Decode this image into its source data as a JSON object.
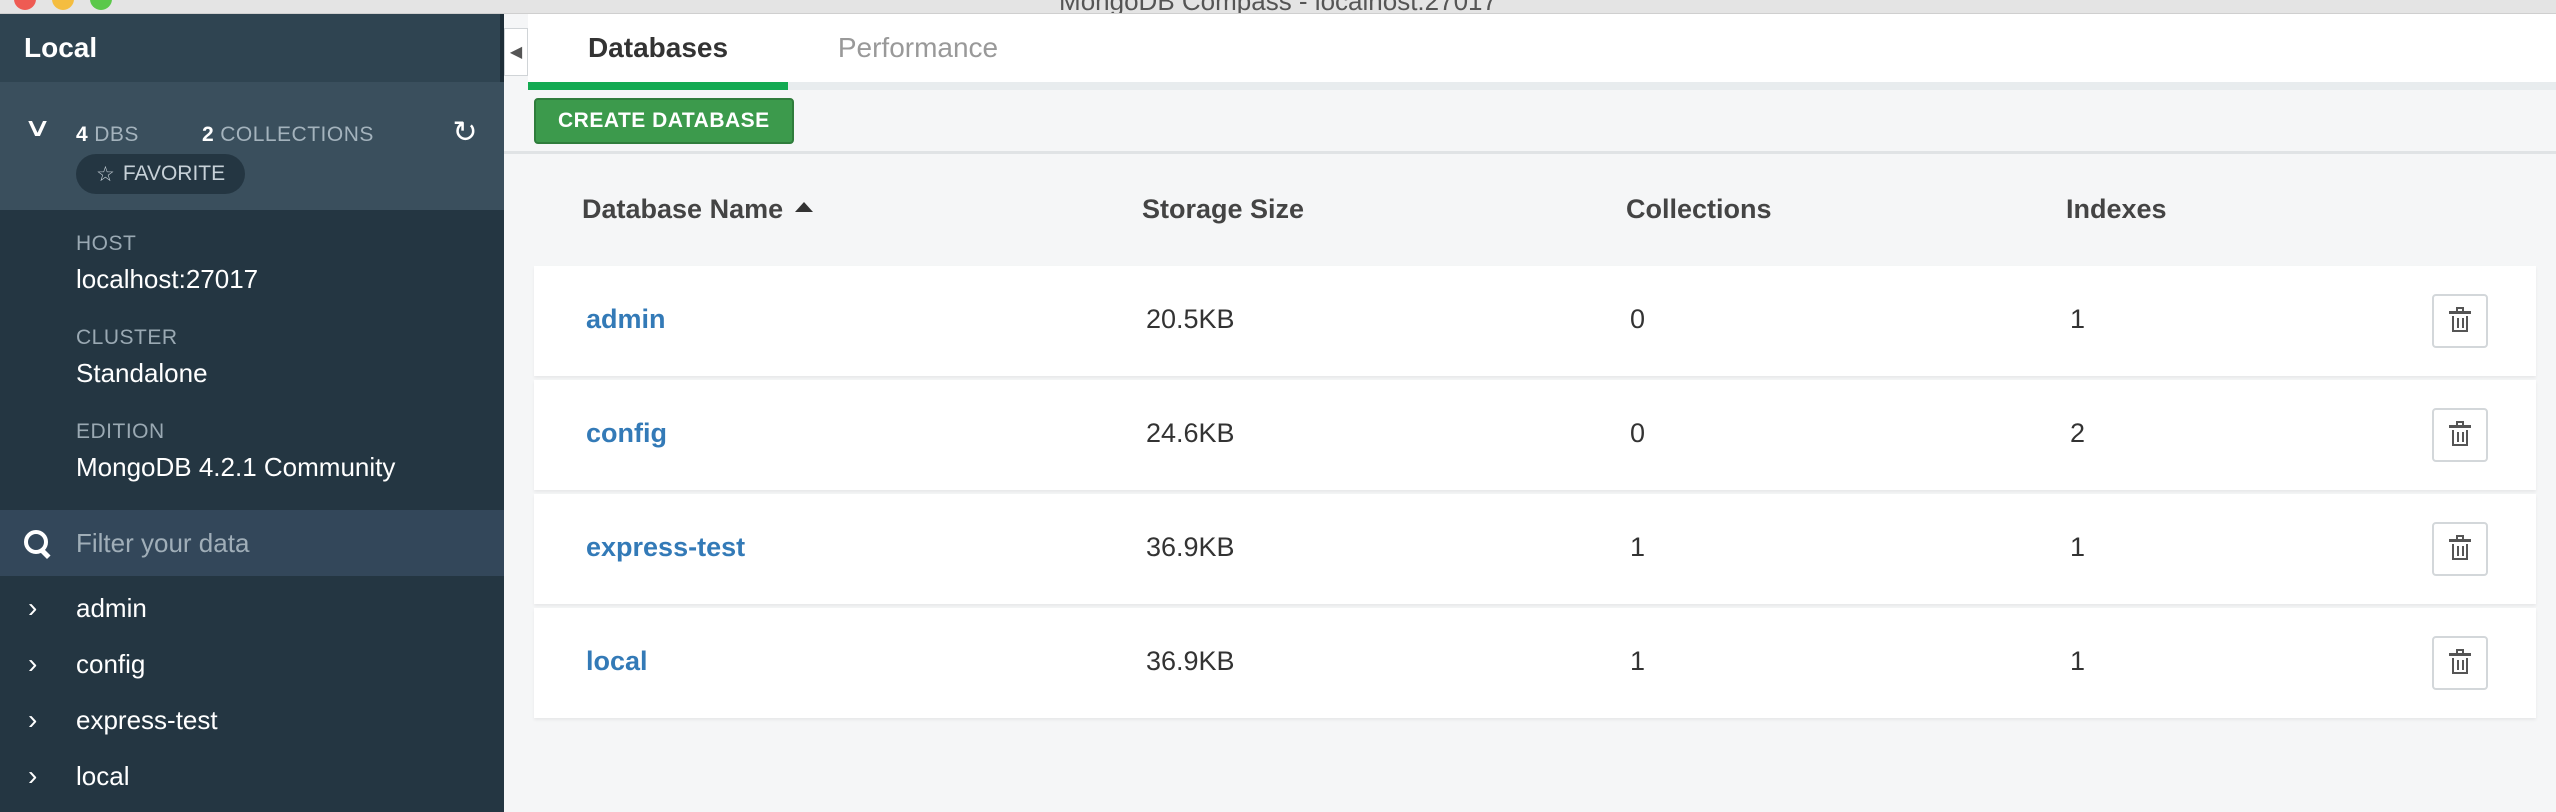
{
  "window": {
    "title": "MongoDB Compass - localhost:27017"
  },
  "sidebar": {
    "header": "Local",
    "stats": {
      "dbs_count": "4",
      "dbs_label": "DBS",
      "collections_count": "2",
      "collections_label": "COLLECTIONS"
    },
    "favorite_label": "FAVORITE",
    "info": [
      {
        "label": "HOST",
        "value": "localhost:27017"
      },
      {
        "label": "CLUSTER",
        "value": "Standalone"
      },
      {
        "label": "EDITION",
        "value": "MongoDB 4.2.1 Community"
      }
    ],
    "filter_placeholder": "Filter your data",
    "databases": [
      "admin",
      "config",
      "express-test",
      "local"
    ]
  },
  "tabs": [
    {
      "label": "Databases",
      "active": true
    },
    {
      "label": "Performance",
      "active": false
    }
  ],
  "toolbar": {
    "create_label": "CREATE DATABASE"
  },
  "table": {
    "headers": {
      "name": "Database Name",
      "size": "Storage Size",
      "collections": "Collections",
      "indexes": "Indexes"
    },
    "rows": [
      {
        "name": "admin",
        "size": "20.5KB",
        "collections": "0",
        "indexes": "1"
      },
      {
        "name": "config",
        "size": "24.6KB",
        "collections": "0",
        "indexes": "2"
      },
      {
        "name": "express-test",
        "size": "36.9KB",
        "collections": "1",
        "indexes": "1"
      },
      {
        "name": "local",
        "size": "36.9KB",
        "collections": "1",
        "indexes": "1"
      }
    ]
  },
  "colors": {
    "accent_green": "#13aa52",
    "button_green": "#3c9a4c",
    "link_blue": "#337ab7",
    "sidebar_bg": "#243642"
  },
  "icons": [
    "chevron-down-icon",
    "refresh-icon",
    "star-icon",
    "search-icon",
    "chevron-right-icon",
    "caret-left-icon",
    "sort-asc-icon",
    "trash-icon"
  ]
}
